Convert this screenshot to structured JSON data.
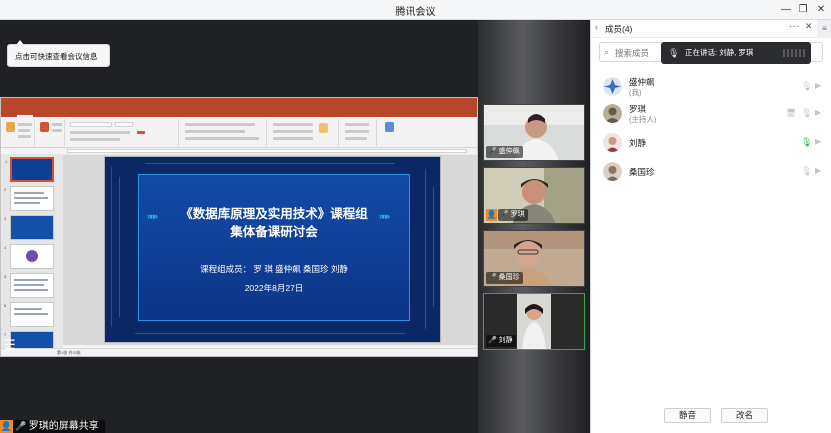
{
  "window": {
    "title": "腾讯会议",
    "controls": {
      "minimize": "—",
      "maximize": "❐",
      "close": "✕"
    }
  },
  "tip": {
    "text": "点击可快速查看会议信息"
  },
  "ppt": {
    "tabs": [
      "文件",
      "开始",
      "插入",
      "设计",
      "切换",
      "动画",
      "幻灯片放映",
      "审阅",
      "视图",
      "PDF工具集",
      "帮助",
      "操作说明搜索"
    ],
    "active_tab_index": 1,
    "status_left": "第1张 共33张",
    "slide": {
      "title_line1": "《数据库原理及实用技术》课程组",
      "title_line2": "集体备课研讨会",
      "members": "课程组成员：  罗 琪  盛仲飙  桑国珍  刘静",
      "date": "2022年8月27日",
      "chevrons": "»»»"
    }
  },
  "video_tiles": [
    {
      "name": "盛仲飙",
      "host": false,
      "active": false
    },
    {
      "name": "罗琪",
      "host": true,
      "active": false
    },
    {
      "name": "桑国珍",
      "host": false,
      "active": false
    },
    {
      "name": "刘静",
      "host": false,
      "active": true
    }
  ],
  "screen_share_label": "罗琪的屏幕共享",
  "panel": {
    "title": "成员(4)",
    "search_placeholder": "搜索成员",
    "speaking_prefix": "正在讲话:",
    "speaking_names": "刘静, 罗琪",
    "members": [
      {
        "name": "盛仲飙",
        "role": "(我)",
        "avatar_color": "#3a6fb8"
      },
      {
        "name": "罗琪",
        "role": "(主持人)",
        "avatar_color": "#8a7d6b"
      },
      {
        "name": "刘静",
        "role": "",
        "avatar_color": "#c7a6a0"
      },
      {
        "name": "桑国珍",
        "role": "",
        "avatar_color": "#9c8a7a"
      }
    ],
    "mute_all_label": "静音",
    "rename_label": "改名"
  },
  "colors": {
    "speaking_mic": "#2fb24a",
    "ppt_accent": "#b7472a",
    "host_badge": "#f08a24"
  }
}
